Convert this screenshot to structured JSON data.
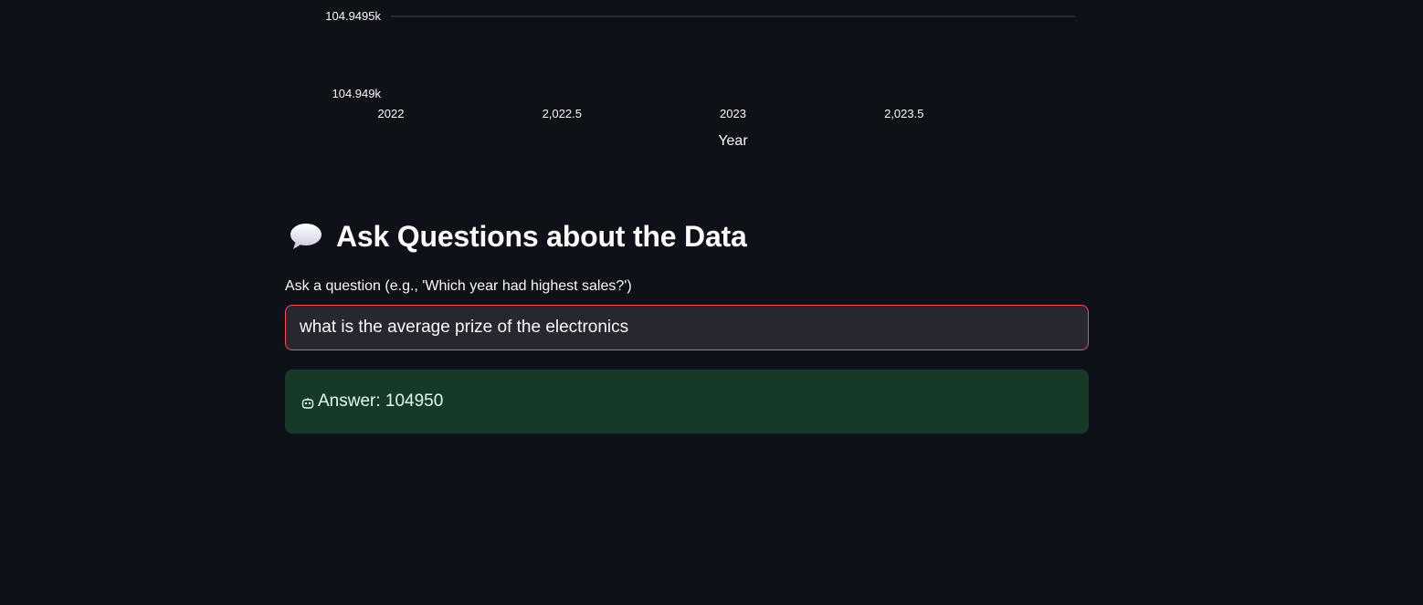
{
  "chart_data": {
    "type": "line",
    "xlabel": "Year",
    "ylabel": "",
    "x_ticks": [
      "2022",
      "2,022.5",
      "2023",
      "2,023.5"
    ],
    "x_tick_values": [
      2022,
      2022.5,
      2023,
      2023.5
    ],
    "y_ticks": [
      "104.9495k",
      "104.949k"
    ],
    "y_tick_values": [
      104949.5,
      104949
    ],
    "xlim": [
      2022,
      2024
    ],
    "ylim": [
      104949,
      104949.5
    ],
    "grid": true,
    "series": []
  },
  "section": {
    "heading": "Ask Questions about the Data",
    "heading_icon": "speech-balloon-icon",
    "question_label": "Ask a question (e.g., 'Which year had highest sales?')",
    "question_value": "what is the average prize of the electronics",
    "answer_text": "Answer: 104950",
    "answer_icon": "robot-face-icon"
  },
  "colors": {
    "background": "#0e1117",
    "input_bg": "#262730",
    "input_border": "#ff4b4b",
    "answer_bg": "#173928",
    "answer_text": "#dffde9",
    "gridline": "#31333f"
  }
}
